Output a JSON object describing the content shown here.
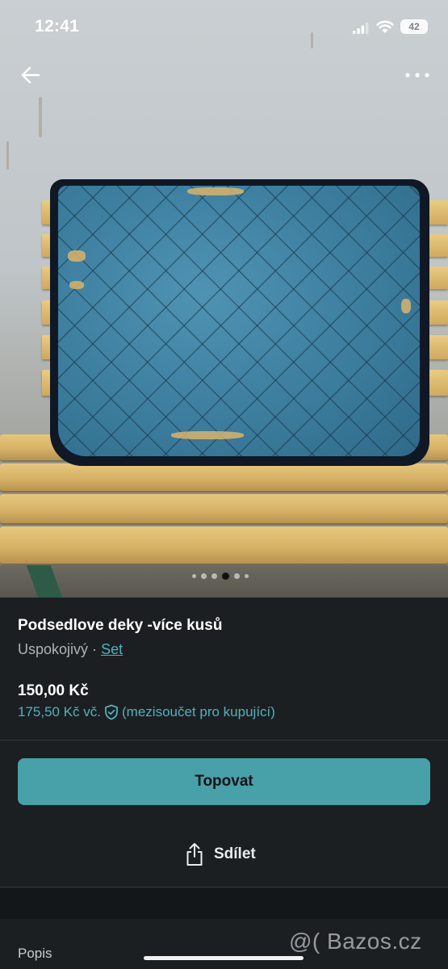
{
  "status_bar": {
    "time": "12:41",
    "battery": "42"
  },
  "photo": {
    "alt": "",
    "carousel_count": 6,
    "carousel_active": 3
  },
  "listing": {
    "title": "Podsedlove deky -více kusů",
    "condition": "Uspokojivý",
    "separator": "·",
    "category_link": "Set",
    "price": "150,00 Kč",
    "buyer_price": "175,50 Kč vč.",
    "buyer_note": "(mezisoučet pro kupující)"
  },
  "actions": {
    "promote_label": "Topovat",
    "share_label": "Sdílet"
  },
  "section": {
    "description_label": "Popis"
  },
  "watermark": "@( Bazos.cz",
  "colors": {
    "accent": "#48a0a8",
    "link": "#4fb2bd",
    "background": "#1b1f21"
  },
  "icons": {
    "back": "arrow-left-icon",
    "more": "more-horizontal-icon",
    "shield": "shield-check-icon",
    "share": "share-icon"
  }
}
